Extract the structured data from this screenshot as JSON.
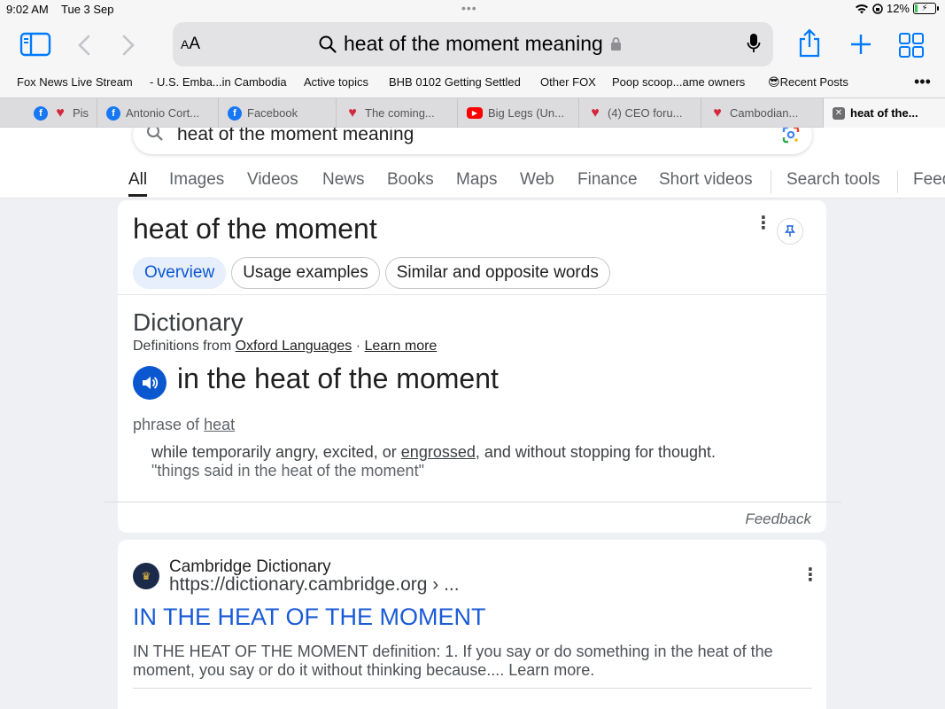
{
  "status": {
    "time": "9:02 AM",
    "date": "Tue 3 Sep",
    "battery": "12%",
    "battery_level": 0.12
  },
  "toolbar": {
    "text_size": "AA",
    "address": "heat of the moment meaning"
  },
  "bookmarks": [
    "Fox News Live Stream",
    "- U.S. Emba...in Cambodia",
    "Active topics",
    "BHB 0102 Getting Settled",
    "Other FOX",
    "Poop scoop...ame owners",
    "Recent Posts"
  ],
  "bookmark_emoji": "😎",
  "tabs": [
    {
      "label": "Pis",
      "icon": "facebook-icon"
    },
    {
      "label": "Antonio Cort...",
      "icon": "facebook-icon"
    },
    {
      "label": "Facebook",
      "icon": "facebook-icon"
    },
    {
      "label": "The coming...",
      "icon": "heart-flag-icon"
    },
    {
      "label": "Big Legs (Un...",
      "icon": "youtube-icon"
    },
    {
      "label": "(4) CEO foru...",
      "icon": "heart-flag-icon"
    },
    {
      "label": "Cambodian...",
      "icon": "heart-flag-icon"
    },
    {
      "label": "heat of the...",
      "icon": "close-icon"
    }
  ],
  "google": {
    "query": "heat of the moment meaning",
    "nav": [
      "All",
      "Images",
      "Videos",
      "News",
      "Books",
      "Maps",
      "Web",
      "Finance",
      "Short videos",
      "Search tools",
      "Feed"
    ]
  },
  "dictionary_card": {
    "term": "heat of the moment",
    "chips": [
      "Overview",
      "Usage examples",
      "Similar and opposite words"
    ],
    "section_title": "Dictionary",
    "defs_from_prefix": "Definitions from",
    "defs_source": "Oxford Languages",
    "defs_sep": "·",
    "learn_more": "Learn more",
    "headword": "in the heat of the moment",
    "pos_prefix": "phrase of",
    "pos_word": "heat",
    "def_before": "while temporarily angry, excited, or",
    "def_link": "engrossed",
    "def_after": ", and without stopping for thought.",
    "example": "\"things said in the heat of the moment\"",
    "feedback": "Feedback"
  },
  "result": {
    "site_name": "Cambridge Dictionary",
    "site_url": "https://dictionary.cambridge.org › ...",
    "title": "IN THE HEAT OF THE MOMENT",
    "snippet": "IN THE HEAT OF THE MOMENT definition: 1. If you say or do something in the heat of the moment, you say or do it without thinking because.... Learn more."
  },
  "colors": {
    "accent": "#0b57d0",
    "link": "#1a5bd6",
    "safari_blue": "#007aff"
  }
}
